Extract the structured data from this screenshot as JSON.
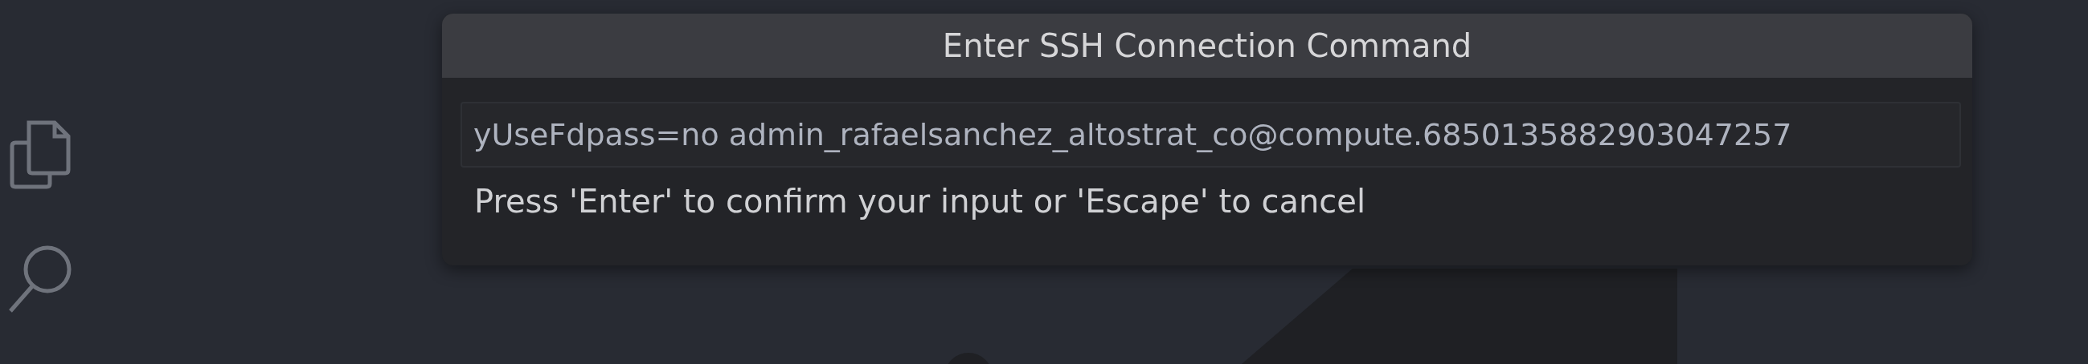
{
  "activity_bar": {
    "items": [
      {
        "kind": "explorer"
      },
      {
        "kind": "search"
      }
    ]
  },
  "quick_input": {
    "title": "Enter SSH Connection Command",
    "input": {
      "value": "yUseFdpass=no admin_rafaelsanchez_altostrat_co@compute.6850135882903047257"
    },
    "message": "Press 'Enter' to confirm your input or 'Escape' to cancel"
  }
}
